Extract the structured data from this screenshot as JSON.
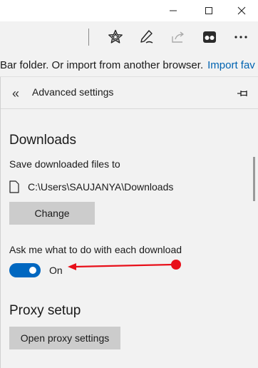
{
  "window_controls": {
    "minimize_icon": "minimize-icon",
    "maximize_icon": "maximize-icon",
    "close_icon": "close-icon"
  },
  "toolbar": {
    "icons": [
      "favorites-star-icon",
      "pen-notes-icon",
      "share-icon",
      "extension-icon",
      "more-icon"
    ]
  },
  "favorites_bar": {
    "text": "Bar folder. Or import from another browser.",
    "link": "Import fav"
  },
  "panel": {
    "back_glyph": "«",
    "title": "Advanced settings",
    "downloads": {
      "heading": "Downloads",
      "save_label": "Save downloaded files to",
      "path": "C:\\Users\\SAUJANYA\\Downloads",
      "change_label": "Change",
      "ask_label": "Ask me what to do with each download",
      "ask_state": "On",
      "ask_enabled": true
    },
    "proxy": {
      "heading": "Proxy setup",
      "button_label": "Open proxy settings"
    }
  },
  "colors": {
    "accent": "#0067c0",
    "link": "#0063b1",
    "annotation": "#e8101a",
    "panel_bg": "#f2f2f2",
    "button_bg": "#cccccc"
  }
}
